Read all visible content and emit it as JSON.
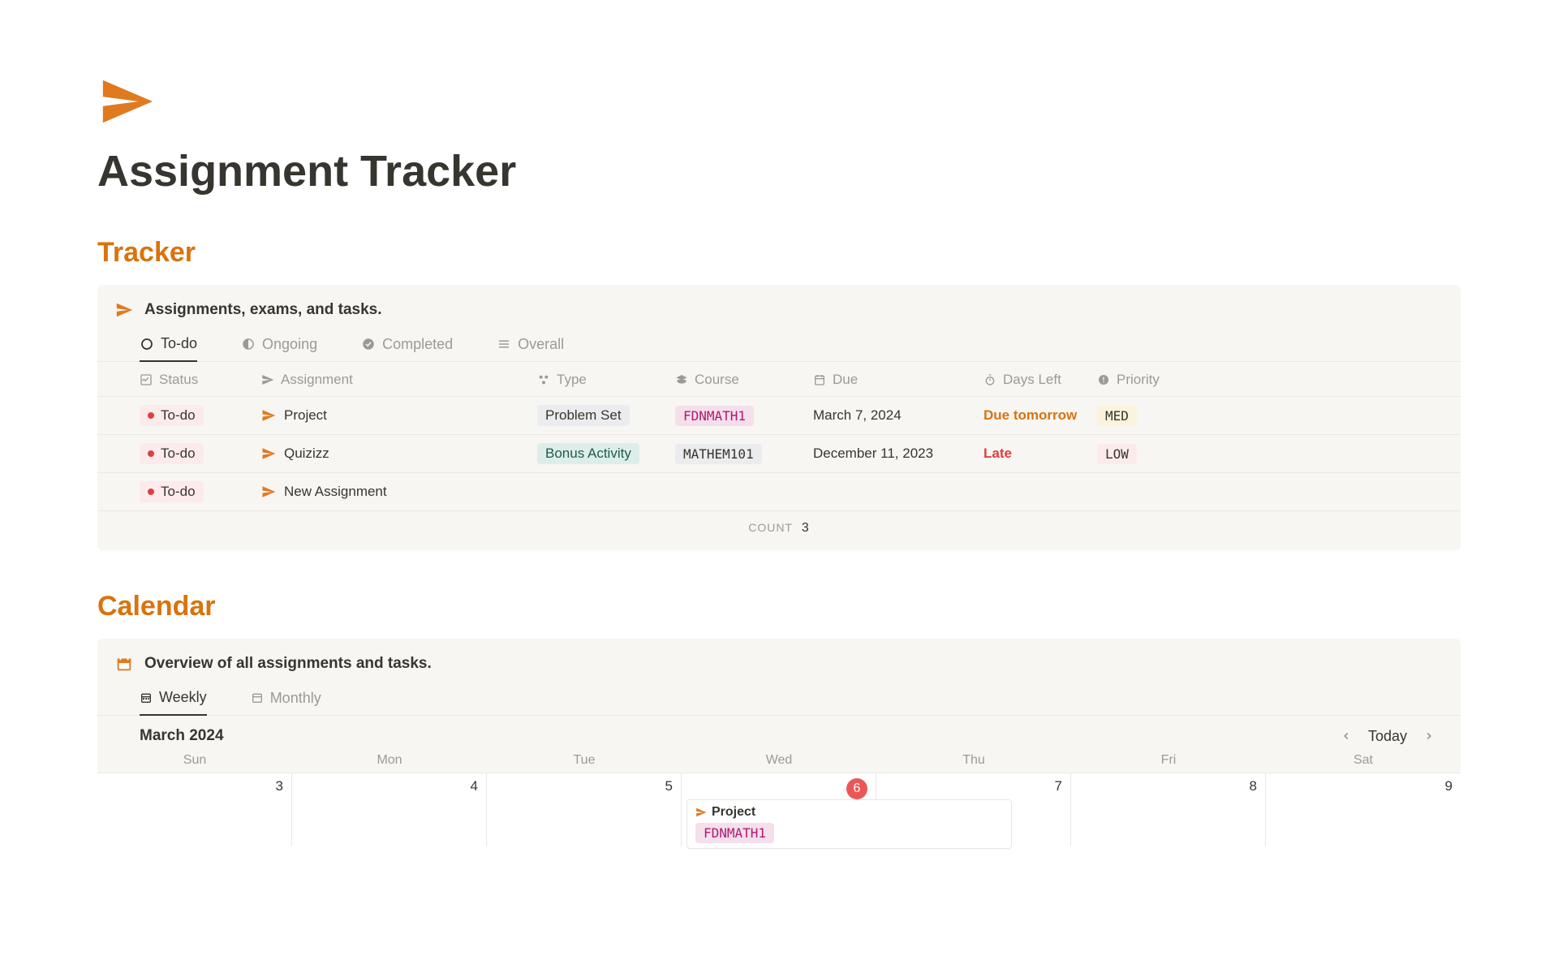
{
  "page": {
    "title": "Assignment Tracker"
  },
  "tracker": {
    "heading": "Tracker",
    "card_title": "Assignments, exams, and tasks.",
    "tabs": [
      "To-do",
      "Ongoing",
      "Completed",
      "Overall"
    ],
    "active_tab": 0,
    "columns": [
      "Status",
      "Assignment",
      "Type",
      "Course",
      "Due",
      "Days Left",
      "Priority"
    ],
    "rows": [
      {
        "status": "To-do",
        "assignment": "Project",
        "type": "Problem Set",
        "type_color": "gray",
        "course": "FDNMATH1",
        "course_color": "pink",
        "due": "March 7, 2024",
        "days_left": "Due tomorrow",
        "days_color": "orange",
        "priority": "MED",
        "priority_color": "med"
      },
      {
        "status": "To-do",
        "assignment": "Quizizz",
        "type": "Bonus Activity",
        "type_color": "green",
        "course": "MATHEM101",
        "course_color": "gray",
        "due": "December 11, 2023",
        "days_left": "Late",
        "days_color": "red",
        "priority": "LOW",
        "priority_color": "low"
      },
      {
        "status": "To-do",
        "assignment": "New Assignment",
        "type": "",
        "type_color": "",
        "course": "",
        "course_color": "",
        "due": "",
        "days_left": "",
        "days_color": "",
        "priority": "",
        "priority_color": ""
      }
    ],
    "count_label": "COUNT",
    "count_value": "3"
  },
  "calendar": {
    "heading": "Calendar",
    "card_title": "Overview of all assignments and tasks.",
    "tabs": [
      "Weekly",
      "Monthly"
    ],
    "active_tab": 0,
    "month_label": "March 2024",
    "today_label": "Today",
    "day_headers": [
      "Sun",
      "Mon",
      "Tue",
      "Wed",
      "Thu",
      "Fri",
      "Sat"
    ],
    "dates": [
      "3",
      "4",
      "5",
      "6",
      "7",
      "8",
      "9"
    ],
    "today_index": 3,
    "event": {
      "title": "Project",
      "course": "FDNMATH1",
      "day_index": 3
    }
  }
}
